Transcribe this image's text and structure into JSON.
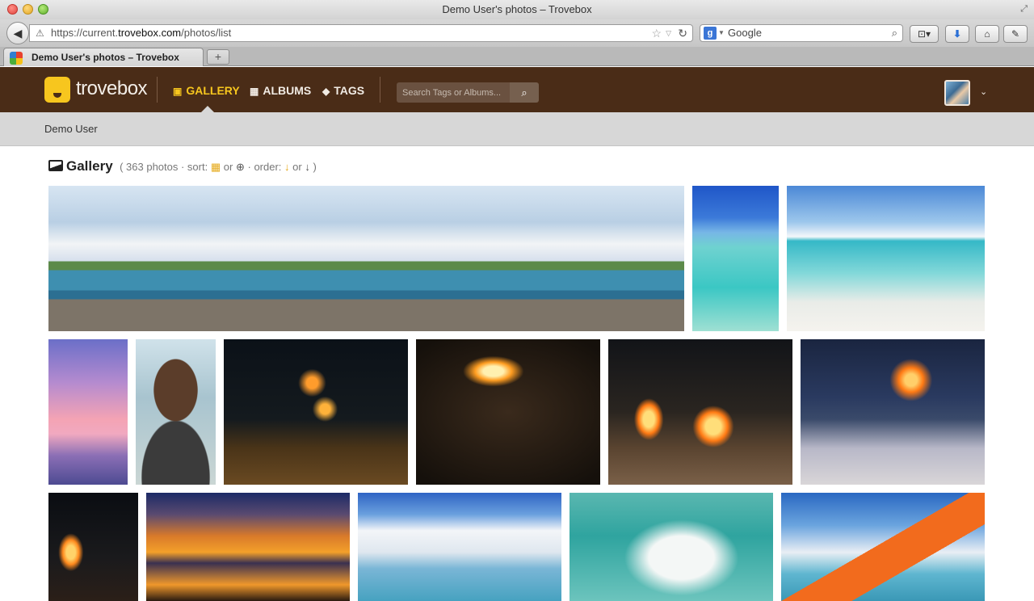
{
  "window": {
    "title": "Demo User's photos – Trovebox"
  },
  "browser": {
    "url_prefix": "https://current.",
    "url_host": "trovebox.com",
    "url_path": "/photos/list",
    "search_engine_label": "Google",
    "tab_title": "Demo User's photos – Trovebox",
    "new_tab_label": "+"
  },
  "site": {
    "logo_text": "trovebox",
    "nav": {
      "gallery": "GALLERY",
      "albums": "ALBUMS",
      "tags": "TAGS"
    },
    "search_placeholder": "Search Tags or Albums...",
    "user_name": "Demo User"
  },
  "gallery": {
    "title": "Gallery",
    "count_text": "( 363 photos · sort:",
    "or1": "or",
    "order_text": "· order:",
    "or2": "or",
    "close": ")"
  },
  "colors": {
    "header_brown": "#4a2c17",
    "accent_yellow": "#f7c61e"
  }
}
